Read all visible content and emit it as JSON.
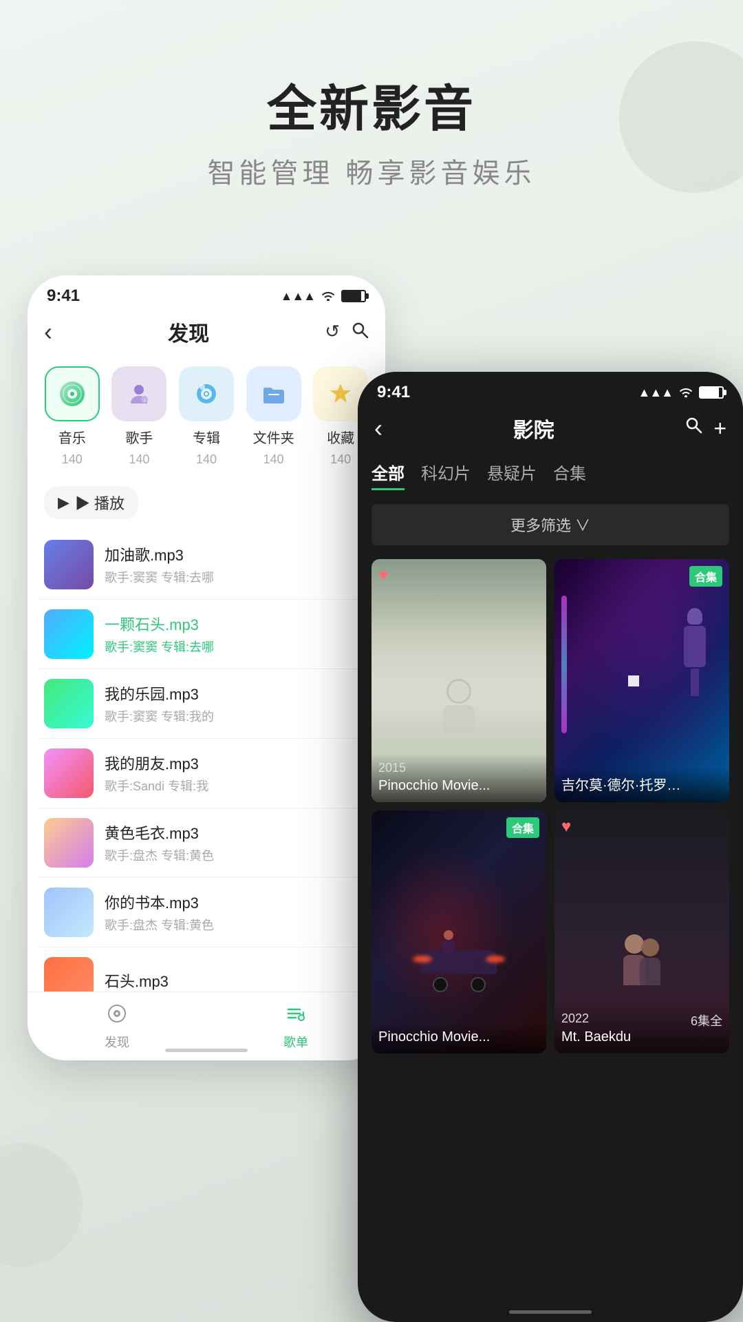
{
  "page": {
    "title": "全新影音",
    "subtitle": "智能管理  畅享影音娱乐"
  },
  "left_phone": {
    "status": {
      "time": "9:41",
      "signal": "▲▲▲",
      "wifi": "wifi",
      "battery": "battery"
    },
    "nav": {
      "back": "‹",
      "title": "发现",
      "refresh": "↺",
      "search": "⌕"
    },
    "categories": [
      {
        "label": "音乐",
        "count": "140",
        "active": true
      },
      {
        "label": "歌手",
        "count": "140"
      },
      {
        "label": "专辑",
        "count": "140"
      },
      {
        "label": "文件夹",
        "count": "140"
      },
      {
        "label": "收藏",
        "count": "140"
      }
    ],
    "play_btn": "▶ 播放",
    "songs": [
      {
        "name": "加油歌.mp3",
        "meta": "歌手:窦窦  专辑:去哪",
        "thumb_class": "thumb-1"
      },
      {
        "name": "一颗石头.mp3",
        "meta": "歌手:窦窦  专辑:去哪",
        "thumb_class": "thumb-2",
        "highlight": true
      },
      {
        "name": "我的乐园.mp3",
        "meta": "歌手:窦窦  专辑:我的",
        "thumb_class": "thumb-3"
      },
      {
        "name": "我的朋友.mp3",
        "meta": "歌手:Sandi  专辑:我",
        "thumb_class": "thumb-4"
      },
      {
        "name": "黄色毛衣.mp3",
        "meta": "歌手:盘杰  专辑:黄色",
        "thumb_class": "thumb-5"
      },
      {
        "name": "你的书本.mp3",
        "meta": "歌手:盘杰  专辑:黄色",
        "thumb_class": "thumb-6"
      },
      {
        "name": "石头.mp3",
        "meta": "",
        "thumb_class": "thumb-7"
      }
    ],
    "tabs": [
      {
        "icon": "◎",
        "label": "发现"
      },
      {
        "icon": "≡♪",
        "label": "歌单",
        "active": true
      }
    ]
  },
  "right_phone": {
    "status": {
      "time": "9:41"
    },
    "nav": {
      "back": "‹",
      "title": "影院",
      "search": "⌕",
      "add": "+"
    },
    "filter_tabs": [
      {
        "label": "全部",
        "active": true
      },
      {
        "label": "科幻片"
      },
      {
        "label": "悬疑片"
      },
      {
        "label": "合集"
      }
    ],
    "more_filter": "更多筛选 ∨",
    "movies": [
      {
        "title": "Pinocchio Movie...",
        "year": "2015",
        "badge": null,
        "heart": true,
        "bg": "movie-bg-1"
      },
      {
        "title": "吉尔莫·德尔·托罗…",
        "year": "",
        "badge": "合集",
        "heart": false,
        "bg": "movie-bg-2"
      },
      {
        "title": "Pinocchio Movie...",
        "year": "",
        "badge": "合集",
        "heart": false,
        "bg": "movie-bg-3"
      },
      {
        "title": "Mt. Baekdu",
        "year": "2022",
        "episodes": "6集全",
        "badge": null,
        "heart": true,
        "bg": "movie-bg-4"
      }
    ]
  }
}
